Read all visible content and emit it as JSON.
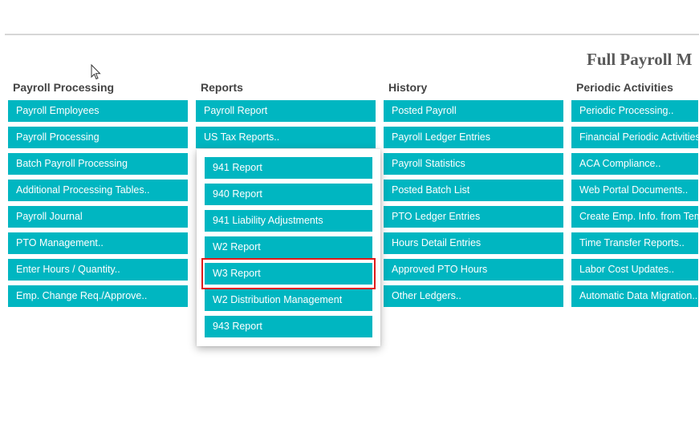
{
  "page_title": "Full Payroll M",
  "columns": [
    {
      "header": "Payroll Processing",
      "items": [
        "Payroll Employees",
        "Payroll Processing",
        "Batch Payroll Processing",
        "Additional Processing Tables..",
        "Payroll Journal",
        "PTO Management..",
        "Enter Hours / Quantity..",
        "Emp. Change Req./Approve.."
      ]
    },
    {
      "header": "Reports",
      "items": [
        "Payroll Report",
        "US Tax Reports.."
      ]
    },
    {
      "header": "History",
      "items": [
        "Posted Payroll",
        "Payroll Ledger Entries",
        "Payroll Statistics",
        "Posted Batch List",
        "PTO Ledger Entries",
        "Hours Detail Entries",
        "Approved PTO Hours",
        "Other Ledgers.."
      ]
    },
    {
      "header": "Periodic Activities",
      "items": [
        "Periodic Processing..",
        "Financial Periodic Activities..",
        "ACA Compliance..",
        "Web Portal Documents..",
        "Create Emp. Info. from Temp",
        "Time Transfer Reports..",
        "Labor Cost Updates..",
        "Automatic Data Migration.."
      ]
    }
  ],
  "flyout": {
    "items": [
      "941 Report",
      "940 Report",
      "941 Liability Adjustments",
      "W2 Report",
      "W3 Report",
      "W2 Distribution Management",
      "943 Report"
    ],
    "highlighted": "W3 Report"
  },
  "colors": {
    "tile": "#00b6c1",
    "highlight": "#e11a1a",
    "title": "#5a5a5a"
  }
}
